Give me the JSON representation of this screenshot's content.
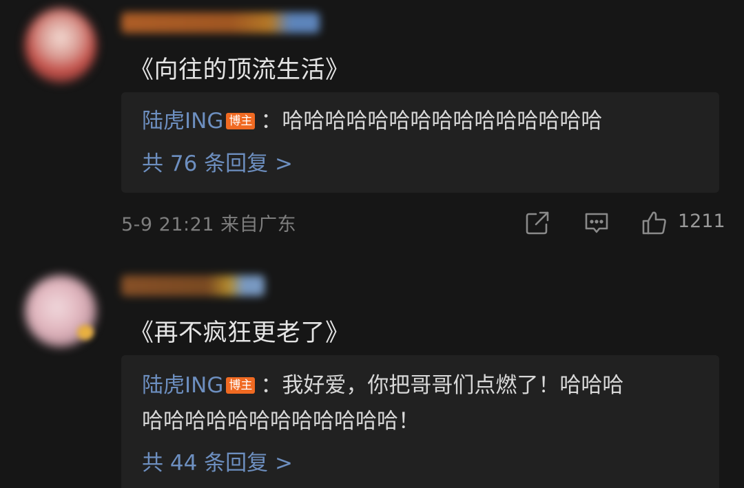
{
  "comments": [
    {
      "text": "《向往的顶流生活》",
      "reply": {
        "author": "陆虎ING",
        "badge": "博主",
        "lines": [
          "：哈哈哈哈哈哈哈哈哈哈哈哈哈哈哈"
        ],
        "count_label": "共 76 条回复 >"
      },
      "date": "5-9 21:21",
      "location": "来自广东",
      "likes": "1211"
    },
    {
      "text": "《再不疯狂更老了》",
      "reply": {
        "author": "陆虎ING",
        "badge": "博主",
        "lines": [
          "：我好爱，你把哥哥们点燃了！哈哈哈",
          "哈哈哈哈哈哈哈哈哈哈哈哈！"
        ],
        "count_label": "共 44 条回复 >"
      }
    }
  ],
  "icons": {
    "share": "share-icon",
    "comment": "comment-icon",
    "like": "thumbs-up-icon"
  },
  "colors": {
    "background": "#161616",
    "reply_box": "#212121",
    "author_link": "#6d8fc0",
    "badge": "#f06a22"
  }
}
